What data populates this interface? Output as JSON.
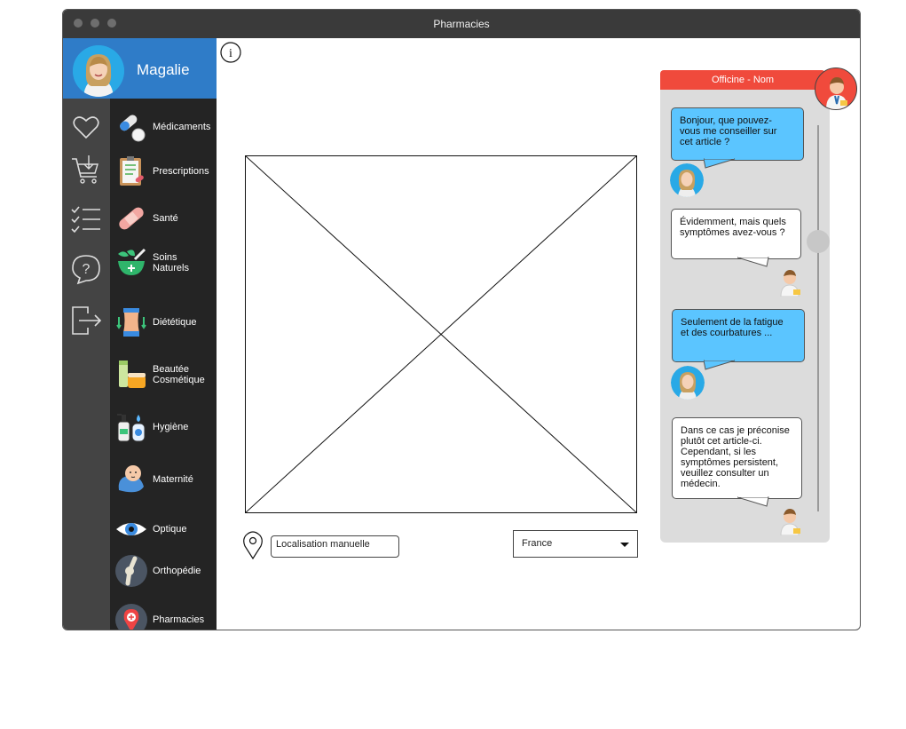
{
  "window": {
    "title": "Pharmacies"
  },
  "profile": {
    "name": "Magalie"
  },
  "left_rail": [
    {
      "icon": "heart-icon"
    },
    {
      "icon": "cart-icon"
    },
    {
      "icon": "checklist-icon"
    },
    {
      "icon": "help-icon"
    },
    {
      "icon": "logout-icon"
    }
  ],
  "categories": [
    {
      "label": "Médicaments",
      "icon": "pills-icon"
    },
    {
      "label": "Prescriptions",
      "icon": "prescription-icon"
    },
    {
      "label": "Santé",
      "icon": "bandage-icon"
    },
    {
      "label": "Soins\nNaturels",
      "icon": "mortar-leaf-icon"
    },
    {
      "label": "Diététique",
      "icon": "waist-icon"
    },
    {
      "label": "Beautée\nCosmétique",
      "icon": "cosmetics-icon"
    },
    {
      "label": "Hygiène",
      "icon": "soap-icon"
    },
    {
      "label": "Maternité",
      "icon": "baby-icon"
    },
    {
      "label": "Optique",
      "icon": "eye-icon"
    },
    {
      "label": "Orthopédie",
      "icon": "bone-joint-icon"
    },
    {
      "label": "Pharmacies",
      "icon": "map-pin-icon"
    }
  ],
  "location": {
    "placeholder": "Localisation manuelle",
    "country": "France"
  },
  "chat": {
    "header": "Officine - Nom",
    "messages": [
      {
        "from": "user",
        "text": "Bonjour, que pouvez-\nvous me conseiller sur\ncet article ?"
      },
      {
        "from": "pharmacist",
        "text": "Évidemment, mais quels\nsymptômes avez-vous ?"
      },
      {
        "from": "user",
        "text": "Seulement de la fatigue\net des courbatures ..."
      },
      {
        "from": "pharmacist",
        "text": "Dans ce cas je préconise\nplutôt cet article-ci.\nCependant, si les\nsymptômes persistent,\nveuillez consulter un\nmédecin."
      }
    ]
  },
  "colors": {
    "titlebar": "#3a3a3a",
    "profile_bg": "#2f7cc8",
    "rail_bg": "#444444",
    "category_bg": "#242424",
    "chat_header": "#f04a3c",
    "user_bubble": "#5bc5ff",
    "chat_bg": "#dcdcdc"
  }
}
